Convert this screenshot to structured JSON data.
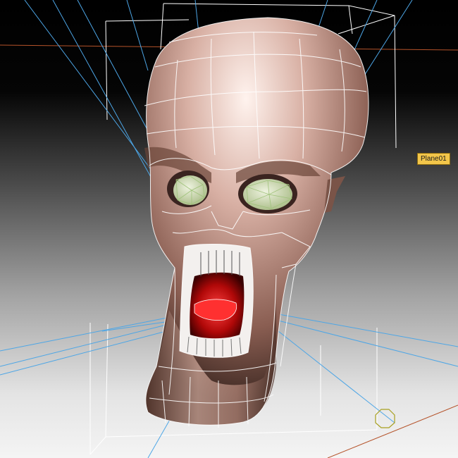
{
  "viewport": {
    "object_tooltip": "Plane01",
    "background_top": "#000000",
    "background_bottom": "#f2f2f2",
    "wireframe_color": "#ffffff",
    "light_ray_color": "#4da6e6",
    "axis_color": "#b5532a",
    "selection_marker_color": "#a8a020",
    "skull_color": "#cfa597",
    "mouth_color": "#c01010",
    "eye_color": "#d9e6c4"
  }
}
